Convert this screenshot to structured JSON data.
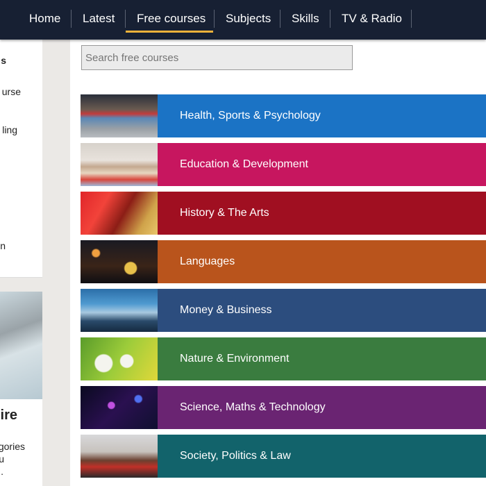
{
  "nav": {
    "items": [
      {
        "label": "Home"
      },
      {
        "label": "Latest"
      },
      {
        "label": "Free courses",
        "active": true
      },
      {
        "label": "Subjects"
      },
      {
        "label": "Skills"
      },
      {
        "label": "TV & Radio"
      }
    ],
    "active_color": "#f0b23a"
  },
  "sidebar": {
    "fragments": [
      "s",
      "urse",
      "ling",
      "n"
    ],
    "card_title_fragment": "ire",
    "card_text_fragments": [
      "gories",
      "u",
      "."
    ]
  },
  "search": {
    "placeholder": "Search free courses"
  },
  "categories": [
    {
      "label": "Health, Sports & Psychology",
      "color": "#1b73c5"
    },
    {
      "label": "Education & Development",
      "color": "#c7165f"
    },
    {
      "label": "History & The Arts",
      "color": "#a00f21"
    },
    {
      "label": "Languages",
      "color": "#b9541c"
    },
    {
      "label": "Money & Business",
      "color": "#2c4d7e"
    },
    {
      "label": "Nature & Environment",
      "color": "#3a7c3f"
    },
    {
      "label": "Science, Maths & Technology",
      "color": "#6a2472"
    },
    {
      "label": "Society, Politics & Law",
      "color": "#12636b"
    }
  ]
}
